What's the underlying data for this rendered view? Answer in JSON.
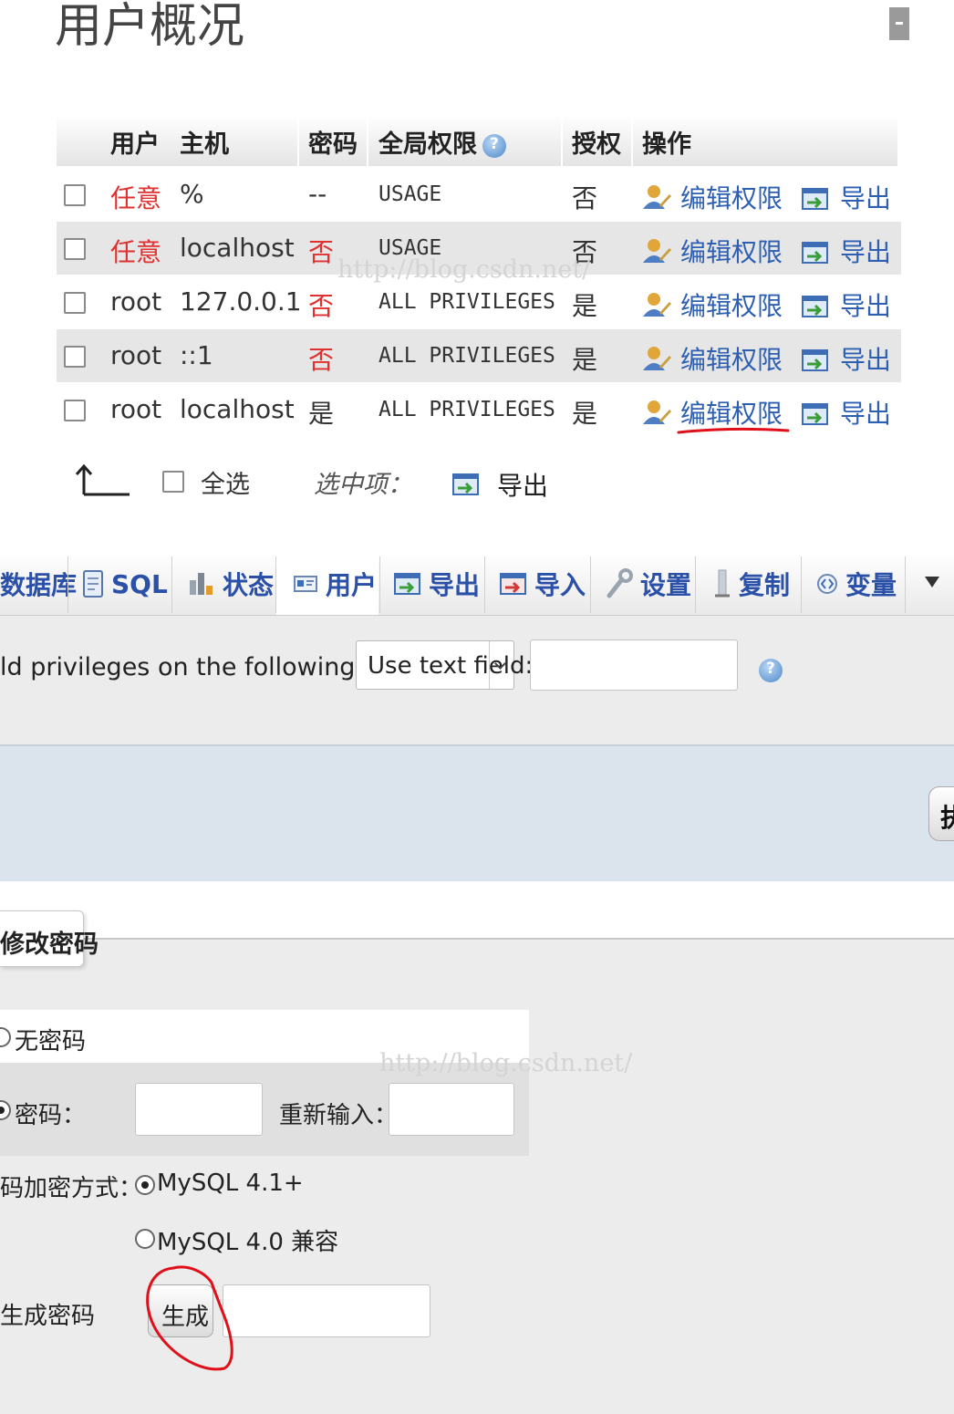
{
  "overview": {
    "title": "用户概况",
    "columns": [
      "用户",
      "主机",
      "密码",
      "全局权限",
      "授权",
      "操作"
    ],
    "rows": [
      {
        "user": "任意",
        "host": "%",
        "password": "--",
        "privileges": "USAGE",
        "grant": "否",
        "edit": "编辑权限",
        "export": "导出"
      },
      {
        "user": "任意",
        "host": "localhost",
        "password": "否",
        "privileges": "USAGE",
        "grant": "否",
        "edit": "编辑权限",
        "export": "导出"
      },
      {
        "user": "root",
        "host": "127.0.0.1",
        "password": "否",
        "privileges": "ALL PRIVILEGES",
        "grant": "是",
        "edit": "编辑权限",
        "export": "导出"
      },
      {
        "user": "root",
        "host": "::1",
        "password": "否",
        "privileges": "ALL PRIVILEGES",
        "grant": "是",
        "edit": "编辑权限",
        "export": "导出"
      },
      {
        "user": "root",
        "host": "localhost",
        "password": "是",
        "privileges": "ALL PRIVILEGES",
        "grant": "是",
        "edit": "编辑权限",
        "export": "导出"
      }
    ],
    "select_all": "全选",
    "with_selected": "选中项：",
    "bulk_export": "导出",
    "watermark": "http://blog.csdn.net/"
  },
  "tabs": [
    {
      "label": "数据库",
      "icon": "database-icon"
    },
    {
      "label": "SQL",
      "icon": "sql-icon"
    },
    {
      "label": "状态",
      "icon": "status-icon"
    },
    {
      "label": "用户",
      "icon": "users-icon"
    },
    {
      "label": "导出",
      "icon": "export-icon"
    },
    {
      "label": "导入",
      "icon": "import-icon"
    },
    {
      "label": "设置",
      "icon": "wrench-icon"
    },
    {
      "label": "复制",
      "icon": "replication-icon"
    },
    {
      "label": "变量",
      "icon": "variables-icon"
    }
  ],
  "database_privs": {
    "label": "ld privileges on the following database:",
    "select_value": "Use text field:",
    "text_value": ""
  },
  "blue_band_button": "执",
  "password": {
    "section_title": "修改密码",
    "no_password": "无密码",
    "password_label": "密码：",
    "retype_label": "重新输入：",
    "hashing_label": "码加密方式：",
    "hash_options": [
      "MySQL 4.1+",
      "MySQL 4.0 兼容"
    ],
    "generate_label": "生成密码",
    "generate_button": "生成",
    "generated_value": "",
    "watermark": "http://blog.csdn.net/"
  },
  "colors": {
    "link": "#2d5fb3",
    "negative": "#e03030",
    "annotation": "#e0101a"
  }
}
